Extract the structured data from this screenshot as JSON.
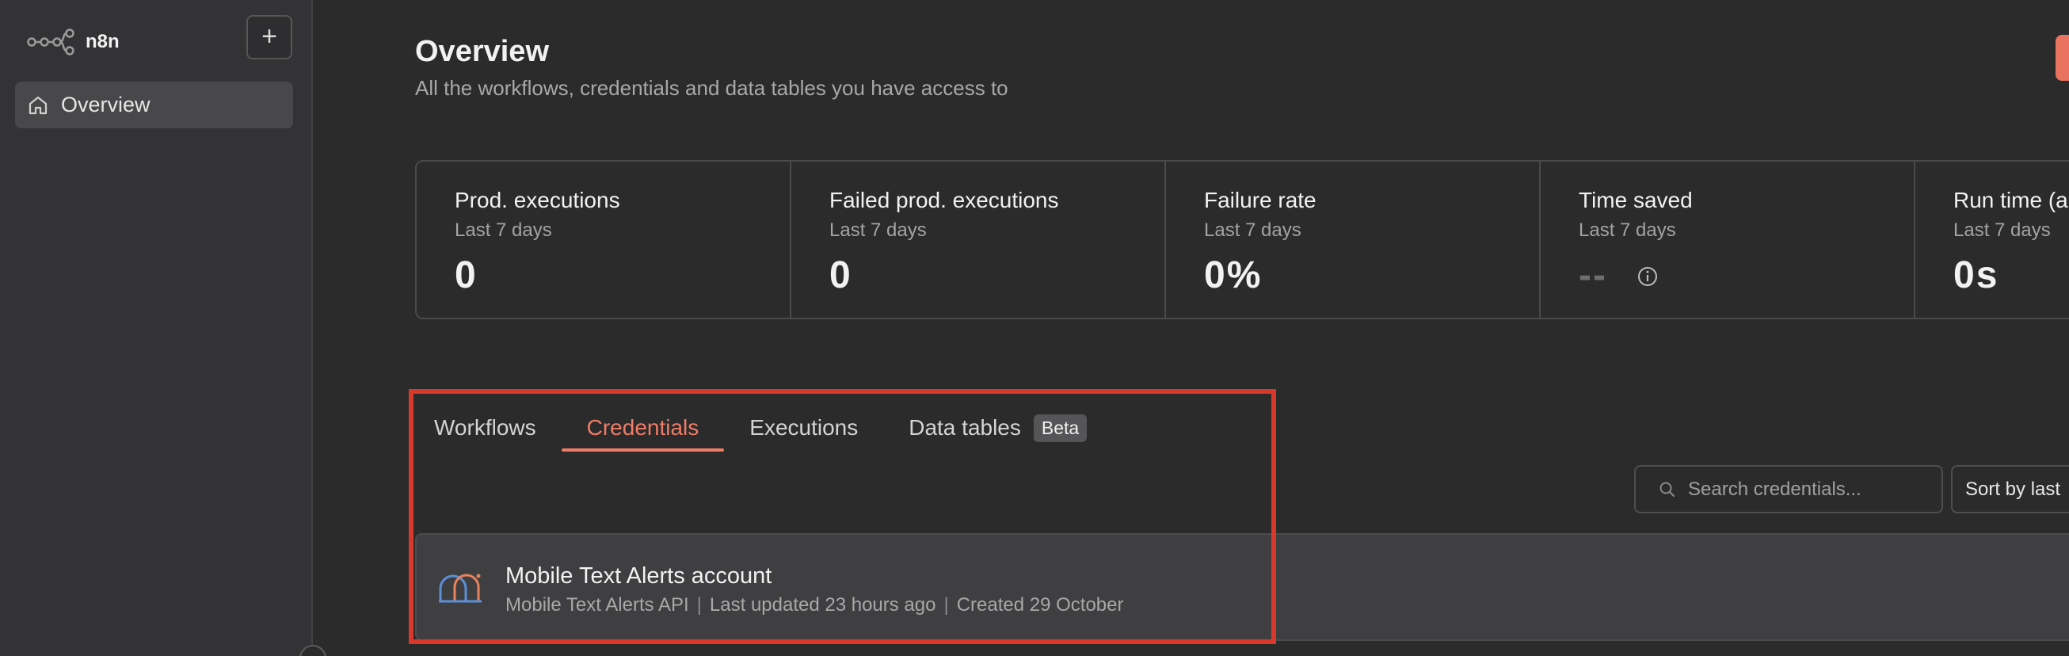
{
  "sidebar": {
    "logo_text": "n8n",
    "add_label": "+",
    "nav": [
      {
        "label": "Overview",
        "icon": "home-icon",
        "active": true
      }
    ]
  },
  "header": {
    "title": "Overview",
    "subtitle": "All the workflows, credentials and data tables you have access to"
  },
  "stats": [
    {
      "title": "Prod. executions",
      "period": "Last 7 days",
      "value": "0"
    },
    {
      "title": "Failed prod. executions",
      "period": "Last 7 days",
      "value": "0"
    },
    {
      "title": "Failure rate",
      "period": "Last 7 days",
      "value": "0%"
    },
    {
      "title": "Time saved",
      "period": "Last 7 days",
      "value": "--",
      "icon": "info-icon"
    },
    {
      "title": "Run time (a",
      "period": "Last 7 days",
      "value": "0s"
    }
  ],
  "tabs": [
    {
      "label": "Workflows",
      "active": false
    },
    {
      "label": "Credentials",
      "active": true
    },
    {
      "label": "Executions",
      "active": false
    },
    {
      "label": "Data tables",
      "badge": "Beta",
      "active": false
    }
  ],
  "search": {
    "placeholder": "Search credentials..."
  },
  "sort": {
    "label": "Sort by last"
  },
  "credentials": [
    {
      "name": "Mobile Text Alerts account",
      "type": "Mobile Text Alerts API",
      "updated": "Last updated 23 hours ago",
      "created": "Created 29 October",
      "icon": "mobile-text-alerts-icon"
    }
  ],
  "colors": {
    "accent": "#f07c67",
    "highlight_box": "#d8392a",
    "background": "#2b2b2b",
    "sidebar": "#333335"
  }
}
